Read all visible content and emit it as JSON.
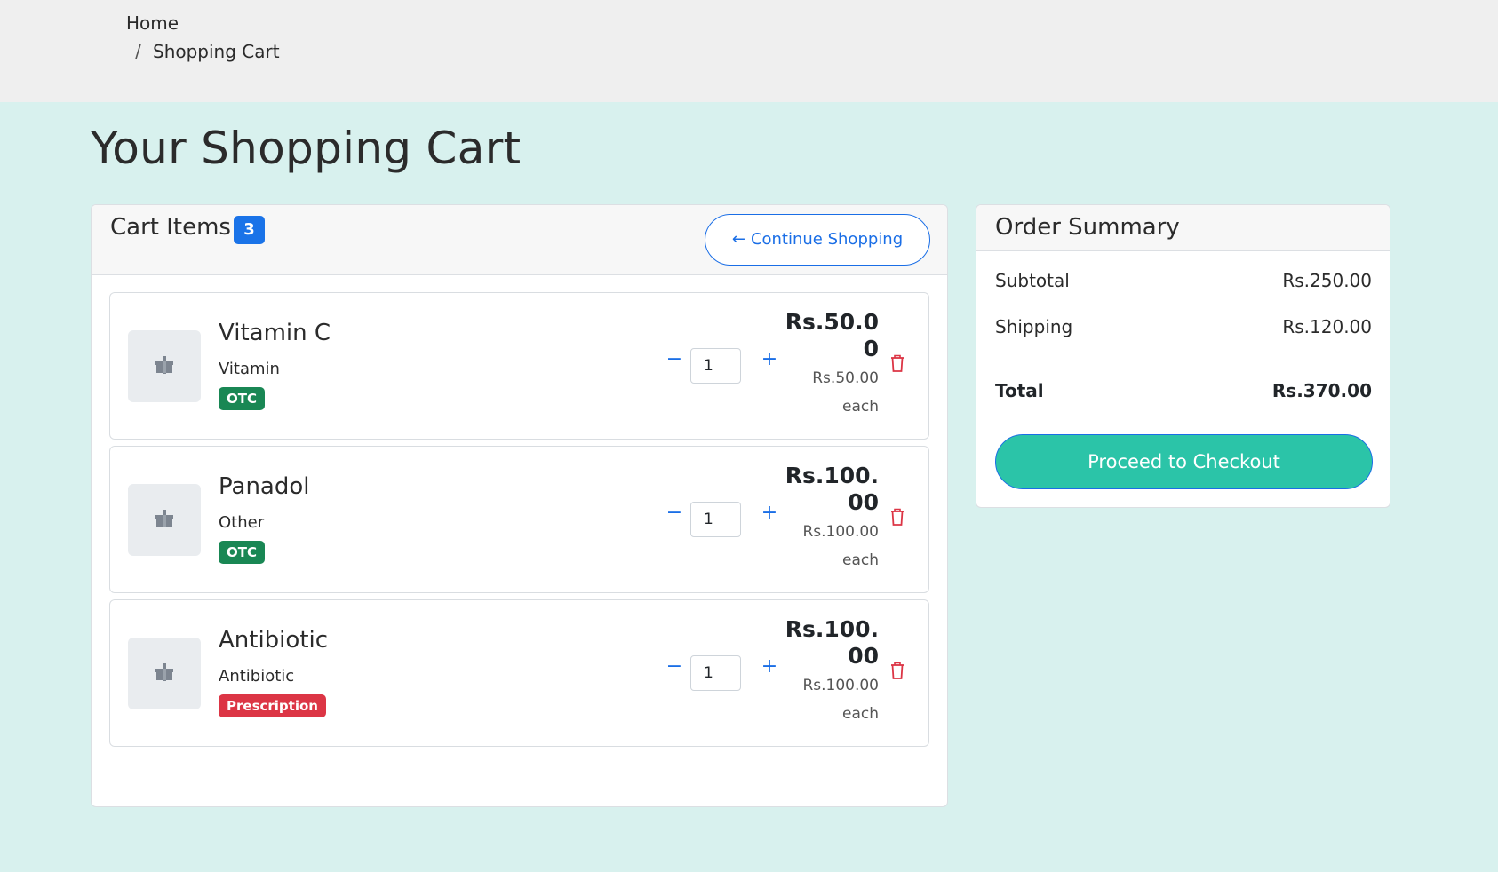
{
  "breadcrumb": {
    "home": "Home",
    "separator": "/",
    "current": "Shopping Cart"
  },
  "page_title": "Your Shopping Cart",
  "cart": {
    "title": "Cart Items",
    "count": "3",
    "continue_label": "Continue Shopping",
    "continue_icon": "arrow-left-icon",
    "items": [
      {
        "name": "Vitamin C",
        "category": "Vitamin",
        "badge": "OTC",
        "badge_color": "#198754",
        "quantity": "1",
        "price": "Rs.50.00",
        "unit_price": "Rs.50.00",
        "each": "each"
      },
      {
        "name": "Panadol",
        "category": "Other",
        "badge": "OTC",
        "badge_color": "#198754",
        "quantity": "1",
        "price": "Rs.100.00",
        "unit_price": "Rs.100.00",
        "each": "each"
      },
      {
        "name": "Antibiotic",
        "category": "Antibiotic",
        "badge": "Prescription",
        "badge_color": "#dc3545",
        "quantity": "1",
        "price": "Rs.100.00",
        "unit_price": "Rs.100.00",
        "each": "each"
      }
    ],
    "minus_symbol": "−",
    "plus_symbol": "+"
  },
  "summary": {
    "title": "Order Summary",
    "subtotal_label": "Subtotal",
    "subtotal_value": "Rs.250.00",
    "shipping_label": "Shipping",
    "shipping_value": "Rs.120.00",
    "total_label": "Total",
    "total_value": "Rs.370.00",
    "checkout_label": "Proceed to Checkout"
  },
  "colors": {
    "page_bg": "#d8f1ee",
    "accent_blue": "#1a6ee6",
    "checkout_teal": "#2bc4a8",
    "delete_red": "#dc3545"
  }
}
